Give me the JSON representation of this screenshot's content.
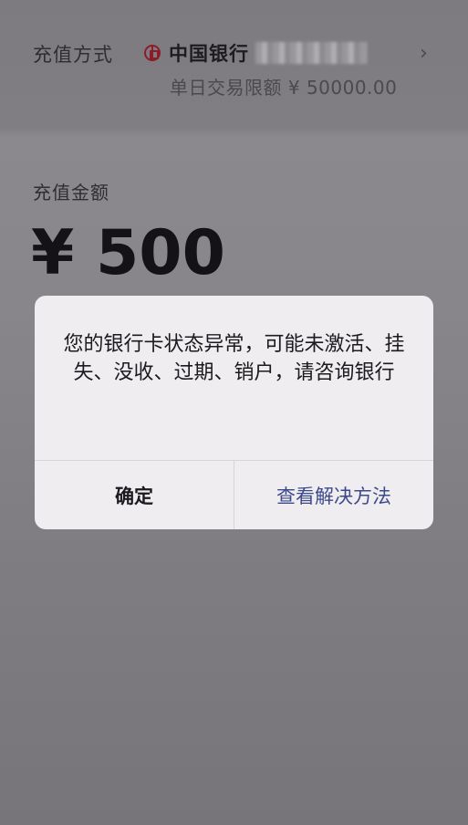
{
  "recharge_method": {
    "label": "充值方式",
    "bank_icon": "bank-of-china-logo",
    "bank_name": "中国银行",
    "chevron": "›",
    "daily_limit": "单日交易限额 ¥ 50000.00"
  },
  "recharge_amount": {
    "label": "充值金额",
    "value": "¥ 500"
  },
  "dialog": {
    "message": "您的银行卡状态异常，可能未激活、挂失、没收、过期、销户，请咨询银行",
    "confirm_label": "确定",
    "solution_label": "查看解决方法",
    "accent_color": "#3d4a8a"
  }
}
